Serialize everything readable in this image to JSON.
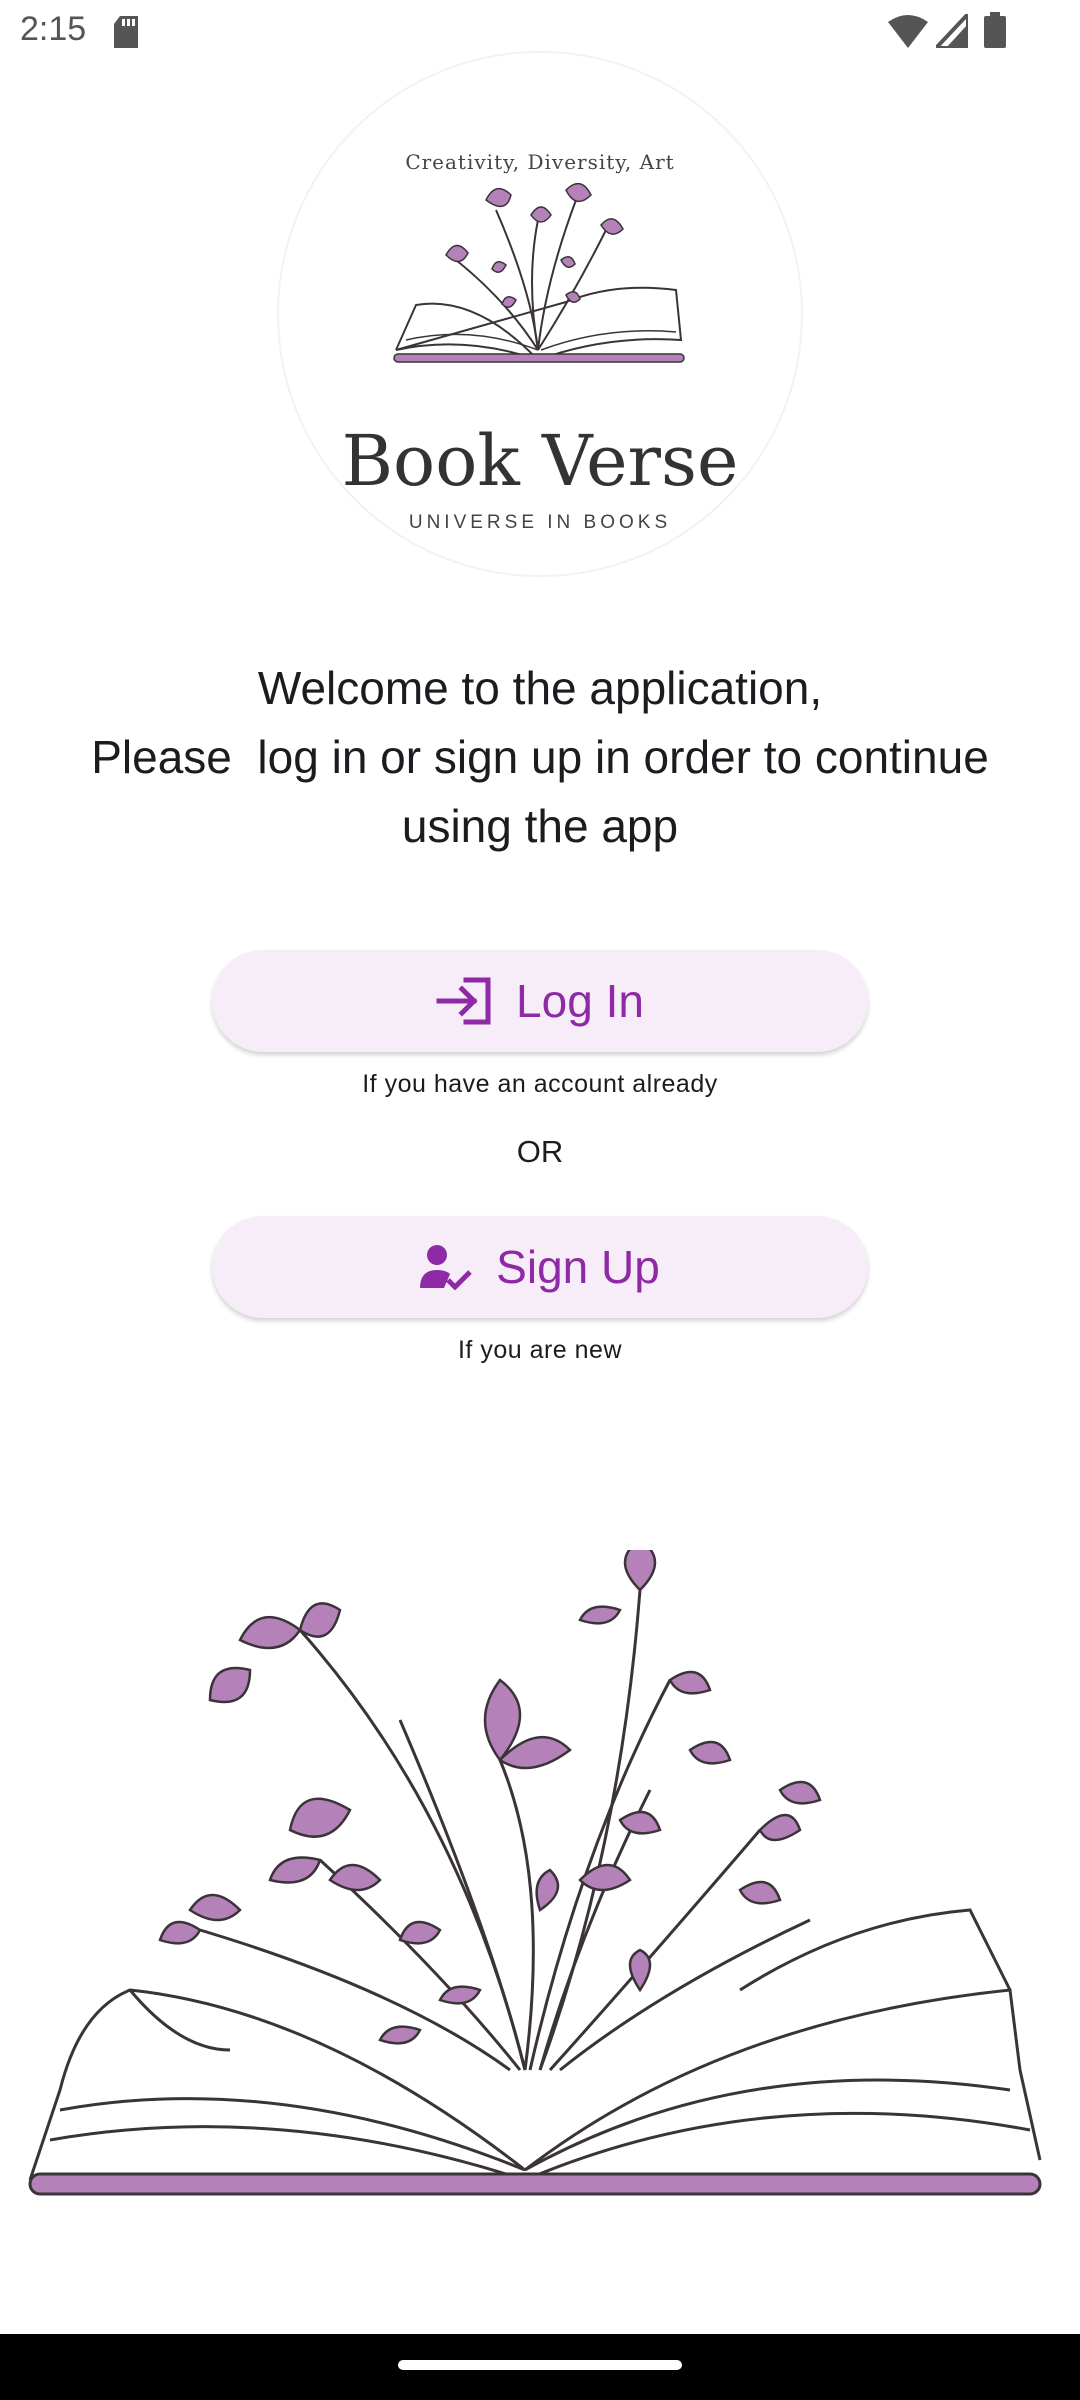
{
  "status_bar": {
    "time": "2:15",
    "icons": [
      "sd-card-icon",
      "wifi-icon",
      "signal-icon",
      "battery-icon"
    ]
  },
  "logo": {
    "tagline": "Creativity, Diversity, Art",
    "title": "Book Verse",
    "subtitle": "UNIVERSE IN BOOKS",
    "accent_color": "#b482b8"
  },
  "welcome": {
    "line1": "Welcome to the application,",
    "line2": "Please  log in or sign up in order to continue",
    "line3": "using the app"
  },
  "login": {
    "label": "Log In",
    "icon": "login-arrow-icon",
    "hint": "If you have an account already"
  },
  "separator": "OR",
  "signup": {
    "label": "Sign Up",
    "icon": "person-check-icon",
    "hint": "If you are new"
  },
  "colors": {
    "button_bg": "#f6edf8",
    "button_text": "#8e2aa6",
    "flower_fill": "#b482b8",
    "line_art": "#3a3438"
  }
}
